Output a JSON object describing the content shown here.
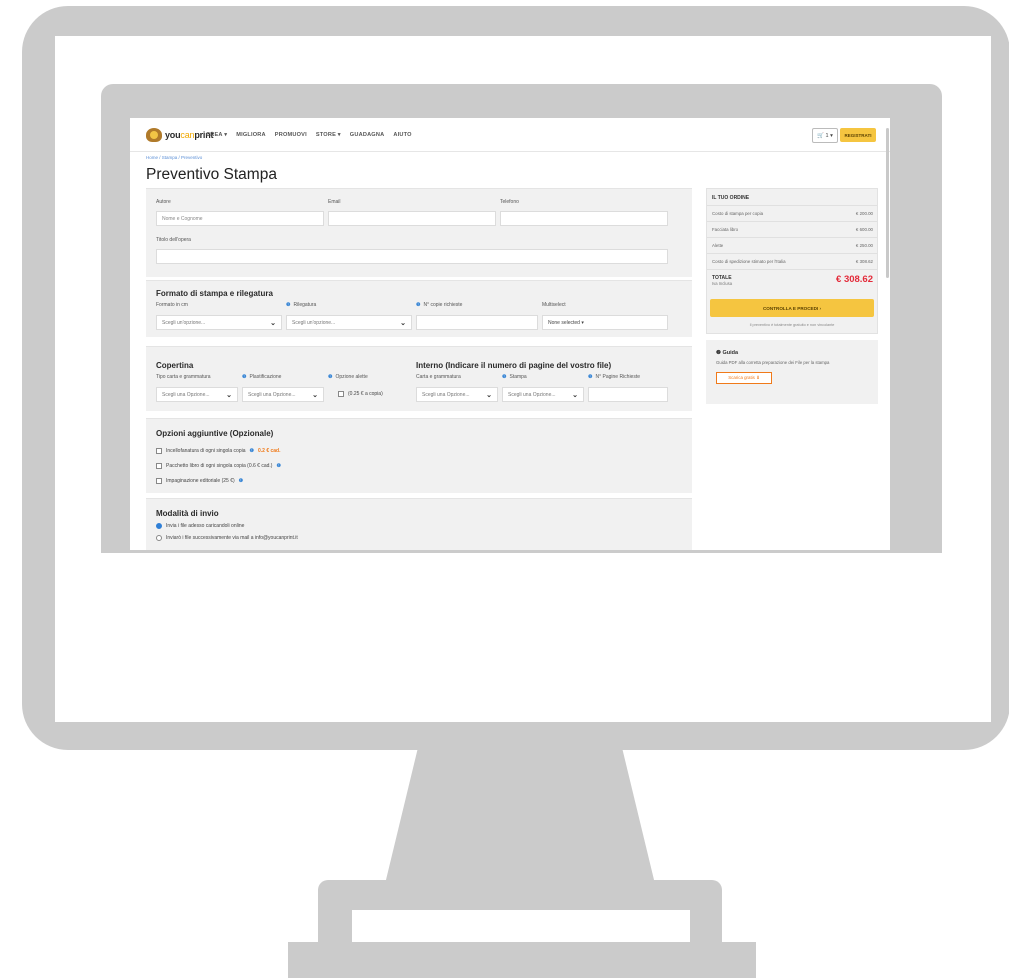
{
  "colors": {
    "monitor_gray": "#cbcbcb",
    "accent_yellow": "#f5c540",
    "total_red": "#e32b3a",
    "info_blue": "#3a87d6",
    "price_orange": "#f07a1a"
  },
  "nav": {
    "logo_prefix": "you",
    "logo_mid": "can",
    "logo_suffix": "print",
    "menu": [
      "CREA ▾",
      "MIGLIORA",
      "PROMUOVI",
      "STORE ▾",
      "GUADAGNA",
      "AIUTO"
    ],
    "cart": "🛒 1 ▾",
    "register": "REGISTRATI"
  },
  "breadcrumb": "Home / Stampa / Preventivo",
  "page_title": "Preventivo Stampa",
  "author": {
    "autore_label": "Autore",
    "autore_placeholder": "Nome e Cognome",
    "email_label": "Email",
    "telefono_label": "Telefono",
    "titolo_label": "Titolo dell'opera"
  },
  "formato": {
    "title": "Formato di stampa e rilegatura",
    "formato_label": "Formato in cm",
    "rilegatura_label": "Rilegatura",
    "copie_label": "N° copie richieste",
    "multiselect_label": "Multiselect",
    "select_placeholder": "Scegli un'opzione...",
    "multiselect_value": "None selected ▾"
  },
  "copertina": {
    "title": "Copertina",
    "carta_label": "Tipo carta e grammatura",
    "plast_label": "Plastificazione",
    "alette_label": "Opzione alette",
    "select_placeholder": "Scegli una Opzione...",
    "alette_checkbox": "(0.25 € a copia)"
  },
  "interno": {
    "title": "Interno (Indicare il numero di pagine del vostro file)",
    "carta_label": "Carta e grammatura",
    "stampa_label": "Stampa",
    "pagine_label": "N° Pagine Richieste",
    "select_placeholder": "Scegli una Opzione..."
  },
  "opzioni": {
    "title": "Opzioni aggiuntive (Opzionale)",
    "items": [
      {
        "label": "Incellofanatura di ogni singola copia",
        "extra": "0.2 € cad."
      },
      {
        "label": "Pacchetto libro di ogni singola copia (0.6 € cad.)",
        "extra": ""
      },
      {
        "label": "Impaginazione editoriale (25 €)",
        "extra": ""
      }
    ]
  },
  "invio": {
    "title": "Modalità di invio",
    "option1": "Invia i file adesso caricandoli online",
    "option2": "Inviarò i file successivamente via mail a info@youcanprint.it"
  },
  "order": {
    "title": "IL TUO ORDINE",
    "rows": [
      {
        "label": "Costo di stampa per copia",
        "value": "€ 200.00"
      },
      {
        "label": "Facciata libro",
        "value": "€ 600.00"
      },
      {
        "label": "Alette",
        "value": "€ 250.00"
      },
      {
        "label": "Costo di spedizione stimato per l'Italia",
        "value": "€ 308.62"
      }
    ],
    "total_label": "TOTALE",
    "total_sub": "Iva Inclusa",
    "total_value": "€ 308.62",
    "cta": "CONTROLLA E PROCEDI ›",
    "note": "Il preventivo è totalmente gratuito e non vincolante"
  },
  "guide": {
    "title": "❷ Guida",
    "text": "Guida PDF alla corretta preparazione dei File per la stampa",
    "button": "Scarica gratis ⬇"
  }
}
